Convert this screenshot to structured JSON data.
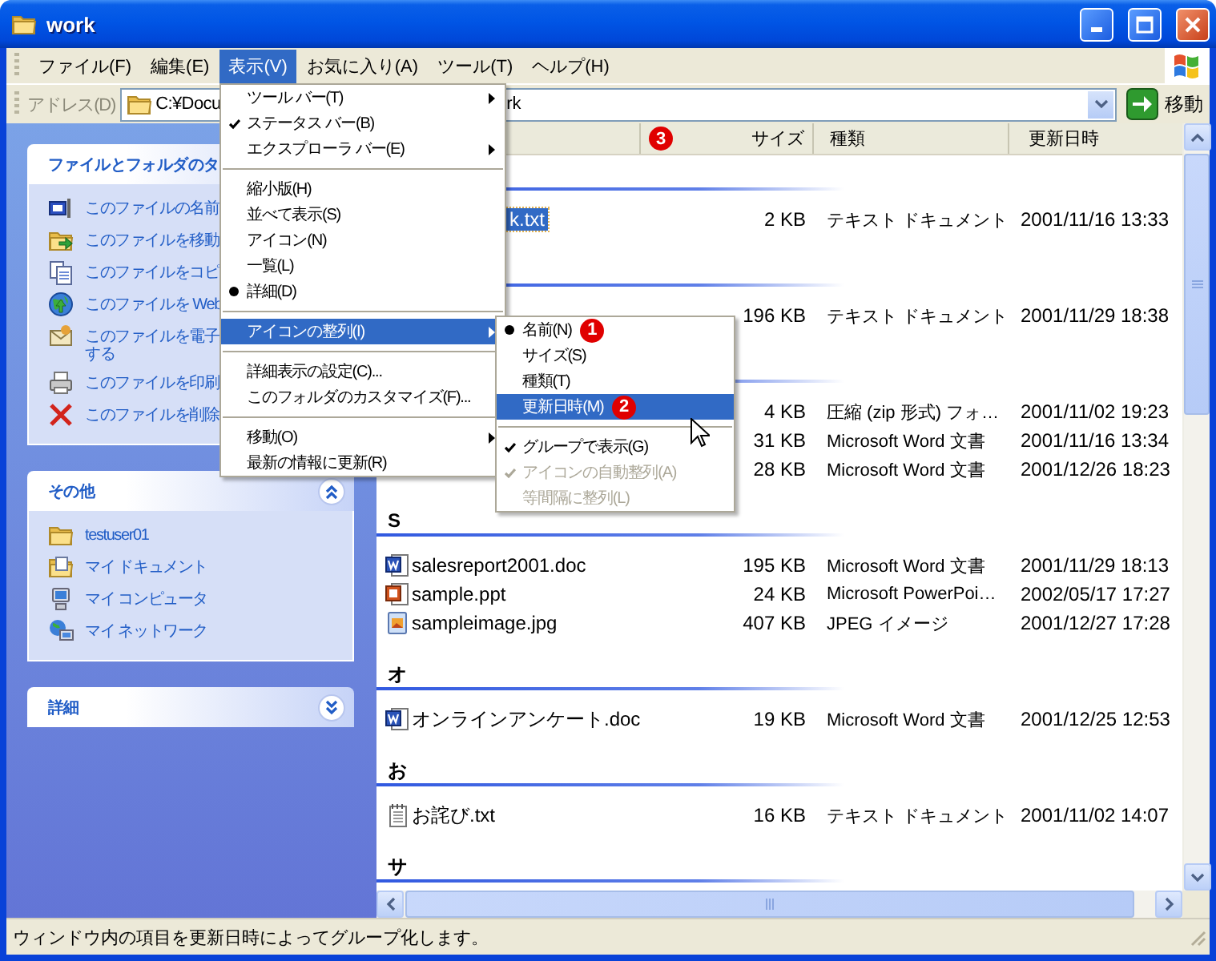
{
  "window": {
    "title": "work"
  },
  "menu_bar": [
    {
      "label": "ファイル(F)",
      "selected": false
    },
    {
      "label": "編集(E)",
      "selected": false
    },
    {
      "label": "表示(V)",
      "selected": true
    },
    {
      "label": "お気に入り(A)",
      "selected": false
    },
    {
      "label": "ツール(T)",
      "selected": false
    },
    {
      "label": "ヘルプ(H)",
      "selected": false
    }
  ],
  "address_bar": {
    "label": "アドレス(D)",
    "value_start": "C:¥Docu",
    "value_end": "rk",
    "go_button": "移動"
  },
  "task_pane": {
    "sections": [
      {
        "title": "ファイルとフォルダのタ",
        "toggle_visible": false,
        "expanded": true,
        "items": [
          {
            "lines": [
              "このファイルの名前"
            ]
          },
          {
            "lines": [
              "このファイルを移動"
            ]
          },
          {
            "lines": [
              "このファイルをコピ"
            ]
          },
          {
            "lines": [
              "このファイルを Web"
            ]
          },
          {
            "lines": [
              "このファイルを電子",
              "する"
            ]
          },
          {
            "lines": [
              "このファイルを印刷"
            ]
          },
          {
            "lines": [
              "このファイルを削除"
            ]
          }
        ]
      },
      {
        "title": "その他",
        "toggle_visible": true,
        "expanded": true,
        "items": [
          {
            "lines": [
              "testuser01"
            ]
          },
          {
            "lines": [
              "マイ ドキュメント"
            ]
          },
          {
            "lines": [
              "マイ コンピュータ"
            ]
          },
          {
            "lines": [
              "マイ ネットワーク"
            ]
          }
        ]
      },
      {
        "title": "詳細",
        "toggle_visible": true,
        "expanded": false
      }
    ]
  },
  "file_list": {
    "columns": [
      {
        "label": "サイズ",
        "badge": "3"
      },
      {
        "label": "種類"
      },
      {
        "label": "更新日時"
      }
    ],
    "groups": [
      {
        "rows": [
          {
            "name": "k.txt",
            "size": "2 KB",
            "type": "テキスト ドキュメント",
            "modified": "2001/11/16 13:33",
            "selected": true
          }
        ]
      },
      {
        "rows": [
          {
            "size": "196 KB",
            "type": "テキスト ドキュメント",
            "modified": "2001/11/29 18:38"
          }
        ]
      },
      {
        "rows": [
          {
            "size": "4 KB",
            "type": "圧縮 (zip 形式) フォ…",
            "modified": "2001/11/02 19:23"
          },
          {
            "size": "31 KB",
            "type": "Microsoft Word 文書",
            "modified": "2001/11/16 13:34"
          },
          {
            "size": "28 KB",
            "type": "Microsoft Word 文書",
            "modified": "2001/12/26 18:23"
          }
        ]
      },
      {
        "label": "S",
        "rows": [
          {
            "name": "salesreport2001.doc",
            "kind": "word",
            "size": "195 KB",
            "type": "Microsoft Word 文書",
            "modified": "2001/11/29 18:13",
            "selected": false
          },
          {
            "name": "sample.ppt",
            "kind": "slides",
            "size": "24 KB",
            "type": "Microsoft PowerPoi…",
            "modified": "2002/05/17 17:27",
            "selected": false
          },
          {
            "name": "sampleimage.jpg",
            "kind": "image",
            "size": "407 KB",
            "type": "JPEG イメージ",
            "modified": "2001/12/27 17:28",
            "selected": false
          }
        ]
      },
      {
        "label": "オ",
        "rows": [
          {
            "name": "オンラインアンケート.doc",
            "kind": "word",
            "size": "19 KB",
            "type": "Microsoft Word 文書",
            "modified": "2001/12/25 12:53",
            "selected": false
          }
        ]
      },
      {
        "label": "お",
        "rows": [
          {
            "name": "お詫び.txt",
            "kind": "text",
            "size": "16 KB",
            "type": "テキスト ドキュメント",
            "modified": "2001/11/02 14:07",
            "selected": false
          }
        ]
      },
      {
        "label": "サ"
      }
    ]
  },
  "view_menu": {
    "items": [
      {
        "kind": "command",
        "label": "ツール バー(T)",
        "selected": false,
        "submenu": true
      },
      {
        "kind": "check",
        "label": "ステータス バー(B)",
        "checked": true,
        "selected": false,
        "submenu": false
      },
      {
        "kind": "command",
        "label": "エクスプローラ バー(E)",
        "selected": false,
        "submenu": true
      },
      {
        "kind": "separator"
      },
      {
        "kind": "radio",
        "label": "縮小版(H)",
        "checked": false,
        "selected": false,
        "submenu": false
      },
      {
        "kind": "radio",
        "label": "並べて表示(S)",
        "checked": false,
        "selected": false,
        "submenu": false
      },
      {
        "kind": "radio",
        "label": "アイコン(N)",
        "checked": false,
        "selected": false,
        "submenu": false
      },
      {
        "kind": "radio",
        "label": "一覧(L)",
        "checked": false,
        "selected": false,
        "submenu": false
      },
      {
        "kind": "radio",
        "label": "詳細(D)",
        "checked": true,
        "selected": false,
        "submenu": false
      },
      {
        "kind": "separator"
      },
      {
        "kind": "command",
        "label": "アイコンの整列(I)",
        "selected": true,
        "submenu": true
      },
      {
        "kind": "separator"
      },
      {
        "kind": "command",
        "label": "詳細表示の設定(C)...",
        "selected": false,
        "submenu": false
      },
      {
        "kind": "command",
        "label": "このフォルダのカスタマイズ(F)...",
        "selected": false,
        "submenu": false
      },
      {
        "kind": "separator"
      },
      {
        "kind": "command",
        "label": "移動(O)",
        "selected": false,
        "submenu": true
      },
      {
        "kind": "command",
        "label": "最新の情報に更新(R)",
        "selected": false,
        "submenu": false
      }
    ]
  },
  "arrange_submenu": {
    "items": [
      {
        "kind": "radio",
        "label": "名前(N)",
        "checked": true,
        "selected": false,
        "disabled": false,
        "badge": "1"
      },
      {
        "kind": "radio",
        "label": "サイズ(S)",
        "checked": false,
        "selected": false,
        "disabled": false
      },
      {
        "kind": "radio",
        "label": "種類(T)",
        "checked": false,
        "selected": false,
        "disabled": false
      },
      {
        "kind": "radio",
        "label": "更新日時(M)",
        "checked": false,
        "selected": true,
        "disabled": false,
        "badge": "2"
      },
      {
        "kind": "separator"
      },
      {
        "kind": "check",
        "label": "グループで表示(G)",
        "checked": true,
        "selected": false,
        "disabled": false
      },
      {
        "kind": "check",
        "label": "アイコンの自動整列(A)",
        "checked": true,
        "selected": false,
        "disabled": true
      },
      {
        "kind": "check",
        "label": "等間隔に整列(L)",
        "checked": false,
        "selected": false,
        "disabled": true
      }
    ]
  },
  "status_bar": {
    "text": "ウィンドウ内の項目を更新日時によってグループ化します。"
  }
}
